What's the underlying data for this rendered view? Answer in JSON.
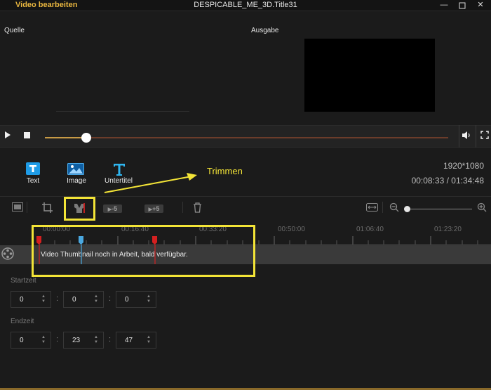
{
  "window": {
    "app_title": "Video bearbeiten",
    "doc_title": "DESPICABLE_ME_3D.Title31"
  },
  "preview": {
    "source_label": "Quelle",
    "output_label": "Ausgabe"
  },
  "player": {
    "progress_fraction": 0.1
  },
  "tools": {
    "text_label": "Text",
    "image_label": "Image",
    "subtitle_label": "Untertitel"
  },
  "info": {
    "resolution": "1920*1080",
    "time": "00:08:33 / 01:34:48"
  },
  "annotation": {
    "label": "Trimmen"
  },
  "toolbar": {
    "back5": "-5",
    "fwd5": "+5",
    "zoom_level_fraction": 0.0
  },
  "timeline": {
    "ticks": [
      "00:00:00",
      "00:16:40",
      "00:33:20",
      "00:50:00",
      "01:06:40",
      "01:23:20"
    ],
    "thumbnail_text": "Video Thumbnail noch in Arbeit, bald verfügbar."
  },
  "trim": {
    "start_label": "Startzeit",
    "start": [
      "0",
      "0",
      "0"
    ],
    "end_label": "Endzeit",
    "end": [
      "0",
      "23",
      "47"
    ]
  },
  "colors": {
    "accent": "#e9b63f",
    "annotation": "#f3e437",
    "marker_red": "#d42020",
    "marker_blue": "#4aa8e0"
  }
}
